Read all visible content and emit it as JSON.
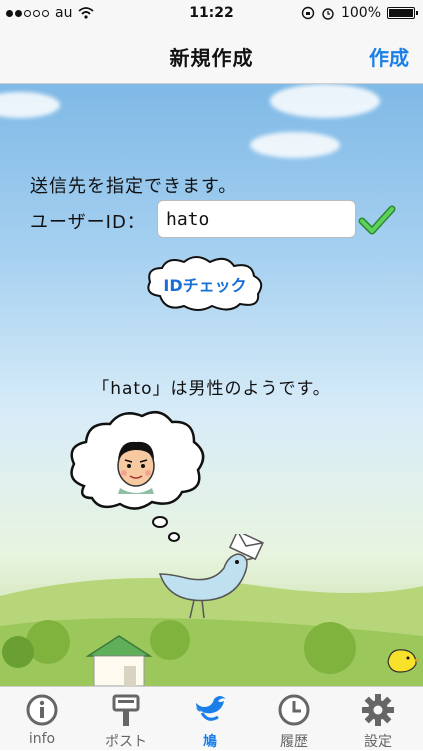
{
  "status": {
    "carrier": "au",
    "time": "11:22",
    "battery": "100%"
  },
  "nav": {
    "title": "新規作成",
    "action": "作成"
  },
  "form": {
    "hint": "送信先を指定できます。",
    "id_label": "ユーザーID：",
    "id_value": "hato",
    "check_button": "IDチェック"
  },
  "result_text": "「hato」は男性のようです。",
  "tabs": [
    {
      "label": "info",
      "icon": "info-icon"
    },
    {
      "label": "ポスト",
      "icon": "mailbox-icon"
    },
    {
      "label": "鳩",
      "icon": "bird-icon"
    },
    {
      "label": "履歴",
      "icon": "clock-icon"
    },
    {
      "label": "設定",
      "icon": "gear-icon"
    }
  ],
  "colors": {
    "accent": "#1a7fe8",
    "check": "#3cb043"
  }
}
